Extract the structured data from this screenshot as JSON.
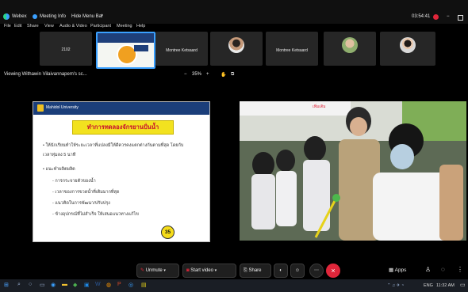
{
  "app": {
    "name": "Webex",
    "tab_meeting_info": "Meeting Info",
    "tab_hide_menu": "Hide Menu Bar",
    "timer": "03:54:41"
  },
  "menu": [
    "File",
    "Edit",
    "Share",
    "View",
    "Audio & Video",
    "Participant",
    "Meeting",
    "Help"
  ],
  "participants": [
    {
      "name": "2102",
      "type": "name"
    },
    {
      "name": "",
      "type": "slide-thumb"
    },
    {
      "name": "Montree Ketsaard",
      "type": "name"
    },
    {
      "name": "",
      "type": "avatar"
    },
    {
      "name": "Montree Ketsaard",
      "type": "name"
    },
    {
      "name": "",
      "type": "avatar"
    },
    {
      "name": "",
      "type": "avatar"
    }
  ],
  "share": {
    "label": "Viewing Withawin Vilaivannapem's sc...",
    "zoom": "35%",
    "zoom_minus": "−",
    "zoom_plus": "+"
  },
  "slide": {
    "institution": "Mahidol University",
    "title": "ทำการทดลองจักรยานปั่นน้ำ",
    "bullet1_line1": "• ให้นักเรียนทำให้ระยะเวลาที่แปลงมีให้ดีควรคงแตกต่างกันตามที่สุด โดยกับ",
    "bullet1_line2": "   เวลาทุ่มลง 5 นาที",
    "bullet2": "• แนะทำผลิตผลิต",
    "sub1": "- การกระจายตัวของน้ำ",
    "sub2": "- เวลาของการขวดน้ำที่เติมมากที่สุด",
    "sub3": "- แนวคิดในการพัฒนา/ปรับปรุง",
    "sub4": "- ข้างอุปกรณ์ที่ไม่สำเร็จ ให้เสนอแนวทางแก้ไข",
    "page": "35"
  },
  "video": {
    "watermark": "เพิ่มเติม"
  },
  "controls": {
    "unmute": "Unmute",
    "start_video": "Start video",
    "share": "Share",
    "apps": "Apps"
  },
  "taskbar": {
    "lang": "ENG",
    "time": "11:32 AM"
  },
  "colors": {
    "accent_red": "#e0263a",
    "slide_yellow": "#f2e21f",
    "slide_title_red": "#c8102e",
    "slide_header_blue": "#1b3e7a"
  }
}
